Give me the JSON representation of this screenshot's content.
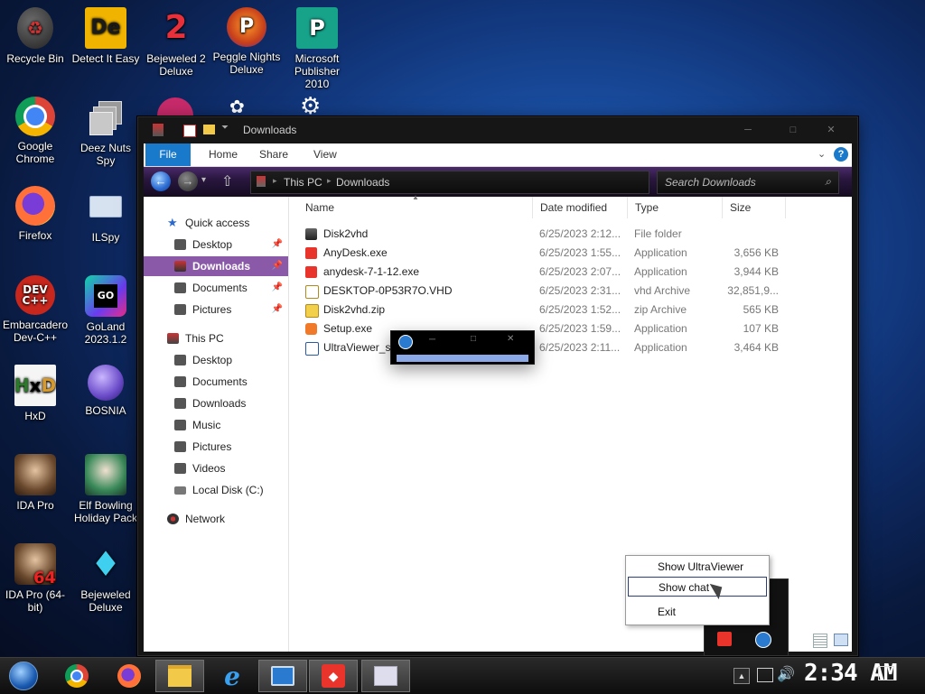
{
  "desktop": {
    "icons": [
      {
        "label": "Recycle Bin"
      },
      {
        "label": "Detect It Easy"
      },
      {
        "label": "Bejeweled 2 Deluxe"
      },
      {
        "label": "Peggle Nights Deluxe"
      },
      {
        "label": "Microsoft Publisher 2010"
      },
      {
        "label": "Google Chrome"
      },
      {
        "label": "Deez Nuts Spy"
      },
      {
        "label": "Firefox"
      },
      {
        "label": "ILSpy"
      },
      {
        "label": "Embarcadero Dev-C++"
      },
      {
        "label": "GoLand 2023.1.2"
      },
      {
        "label": "HxD"
      },
      {
        "label": "BOSNIA"
      },
      {
        "label": "IDA Pro"
      },
      {
        "label": "Elf Bowling Holiday Pack"
      },
      {
        "label": "IDA Pro (64-bit)"
      },
      {
        "label": "Bejeweled Deluxe"
      }
    ]
  },
  "explorer": {
    "title": "Downloads",
    "ribbon": {
      "tabs": [
        "File",
        "Home",
        "Share",
        "View"
      ]
    },
    "address": {
      "path": [
        "This PC",
        "Downloads"
      ]
    },
    "search_placeholder": "Search Downloads",
    "nav": {
      "quick_access": "Quick access",
      "quick_items": [
        "Desktop",
        "Downloads",
        "Documents",
        "Pictures"
      ],
      "this_pc": "This PC",
      "pc_items": [
        "Desktop",
        "Documents",
        "Downloads",
        "Music",
        "Pictures",
        "Videos",
        "Local Disk (C:)"
      ],
      "network": "Network"
    },
    "columns": [
      "Name",
      "Date modified",
      "Type",
      "Size"
    ],
    "files": [
      {
        "name": "Disk2vhd",
        "date": "6/25/2023 2:12...",
        "type": "File folder",
        "size": "",
        "icon": "folder-icon"
      },
      {
        "name": "AnyDesk.exe",
        "date": "6/25/2023 1:55...",
        "type": "Application",
        "size": "3,656 KB",
        "icon": "anydesk-icon"
      },
      {
        "name": "anydesk-7-1-12.exe",
        "date": "6/25/2023 2:07...",
        "type": "Application",
        "size": "3,944 KB",
        "icon": "anydesk-icon"
      },
      {
        "name": "DESKTOP-0P53R7O.VHD",
        "date": "6/25/2023 2:31...",
        "type": "vhd Archive",
        "size": "32,851,9...",
        "icon": "vhd-icon"
      },
      {
        "name": "Disk2vhd.zip",
        "date": "6/25/2023 1:52...",
        "type": "zip Archive",
        "size": "565 KB",
        "icon": "zip-icon"
      },
      {
        "name": "Setup.exe",
        "date": "6/25/2023 1:59...",
        "type": "Application",
        "size": "107 KB",
        "icon": "setup-icon"
      },
      {
        "name": "UltraViewer_set",
        "date": "6/25/2023 2:11...",
        "type": "Application",
        "size": "3,464 KB",
        "icon": "ultraviewer-icon"
      }
    ]
  },
  "context_menu": {
    "items": [
      "Show UltraViewer",
      "Show chat",
      "Exit"
    ]
  },
  "taskbar": {
    "clock": "2:34 AM"
  },
  "colors": {
    "ribbon_file": "#1979ca",
    "accent_purple": "#4a2a6a",
    "selected_nav": "#8a5aa8"
  }
}
